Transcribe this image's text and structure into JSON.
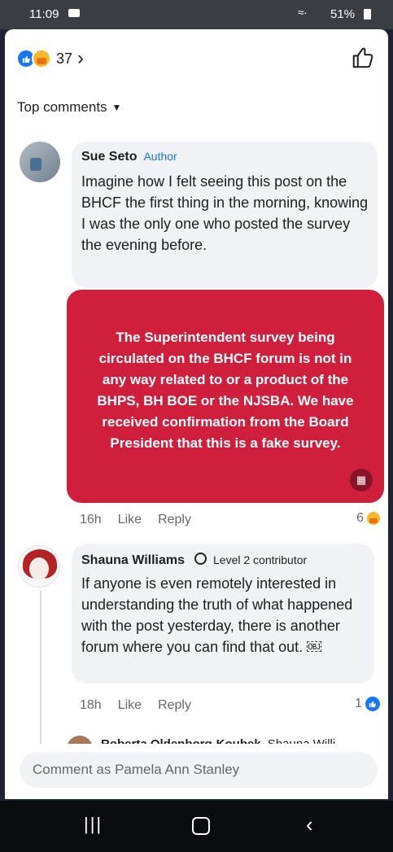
{
  "status_bar": {
    "time": "11:09",
    "battery": "51%"
  },
  "reactions": {
    "count": "37"
  },
  "sort": {
    "label": "Top comments"
  },
  "comments": [
    {
      "author": "Sue Seto",
      "tag": "Author",
      "text": "Imagine how I felt seeing this post on the BHCF the first thing in the morning, knowing I was the only one who posted the survey the evening before.",
      "image_text": "The Superintendent survey being circulated on the BHCF forum is not in any way related to or a product of the BHPS, BH BOE or the NJSBA. We have received confirmation from the Board President that this is a fake survey.",
      "time": "16h",
      "like": "Like",
      "reply": "Reply",
      "reaction_count": "6"
    },
    {
      "author": "Shauna Williams",
      "tag": "Level 2 contributor",
      "text": "If anyone is even remotely interested in understanding the truth of what happened with the post yesterday, there is another forum where you can find that out. ￼",
      "time": "18h",
      "like": "Like",
      "reply": "Reply",
      "reaction_count": "1"
    }
  ],
  "reply_preview": {
    "author": "Roberta Oldenborg-Koubek",
    "text": "Shauna Willi"
  },
  "composer": {
    "placeholder": "Comment as Pamela Ann Stanley"
  },
  "colors": {
    "accent": "#1877f2",
    "image_bg": "#cf1f3c"
  }
}
